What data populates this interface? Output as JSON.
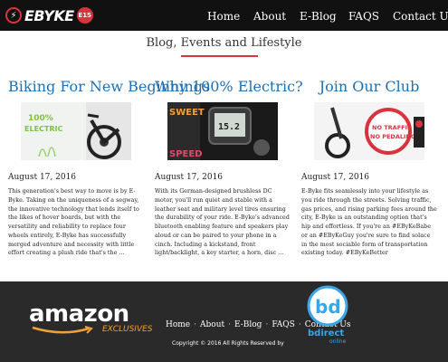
{
  "header": {
    "logo_text": "EBYKE",
    "logo_badge": "E15",
    "nav": [
      {
        "label": "Home"
      },
      {
        "label": "About"
      },
      {
        "label": "E-Blog"
      },
      {
        "label": "FAQS"
      },
      {
        "label": "Contact Us"
      }
    ]
  },
  "section": {
    "title": "Blog, Events and Lifestyle"
  },
  "posts": [
    {
      "title": "Biking For New Beginnings",
      "image_text": "100% ELECTRIC",
      "date": "August 17, 2016",
      "body": "This generation's best way to move is by E-Byke. Taking on the uniqueness of a segway, the innovative technology that lends itself to the likes of hover boards, but with the versatility and reliability to replace four wheels entirely, E-Byke has successfully merged adventure and necessity with little effort creating a plush ride that's the ..."
    },
    {
      "title": "Why 100% Electric?",
      "image_text_top": "SWEET",
      "image_text_bottom": "SPEED",
      "image_screen": "15.2",
      "date": "August 17, 2016",
      "body": "With its German-designed brushless DC motor, you'll run quiet and stable with a leather seat and military level tires ensuring the durability of your ride. E-Byke's advanced bluetooth enabling feature and speakers play aloud or can be paired to your phone in a cinch. Including a kickstand, front light/backlight, a key starter, a horn, disc ..."
    },
    {
      "title": "Join Our Club",
      "image_text_top": "NO TRAFFIC",
      "image_text_bottom": "NO PEDALING",
      "date": "August 17, 2016",
      "body": "E-Byke fits seamlessly into your lifestyle as you ride through the streets. Solving traffic, gas prices, and rising parking fees around the city, E-Byke is an outstanding option that's hip and effortless. If you're an #EByKeBabe or an #EByKeGuy you're sure to find solace in the most sociable form of transportation existing today. #EByKeBetter"
    }
  ],
  "footer": {
    "amazon": "amazon",
    "amazon_sub": "EXCLUSIVES",
    "nav": [
      "Home",
      "About",
      "E-Blog",
      "FAQS",
      "Contact Us"
    ],
    "copyright": "Copyright © 2016 All Rights Reserved by",
    "bd_mark": "bd",
    "bd_text": "bdirect",
    "bd_sub": "online"
  },
  "colors": {
    "accent": "#d8343f",
    "title_blue": "#1f6fb5",
    "header_bg": "#111111",
    "footer_bg": "#2a2a2a"
  }
}
